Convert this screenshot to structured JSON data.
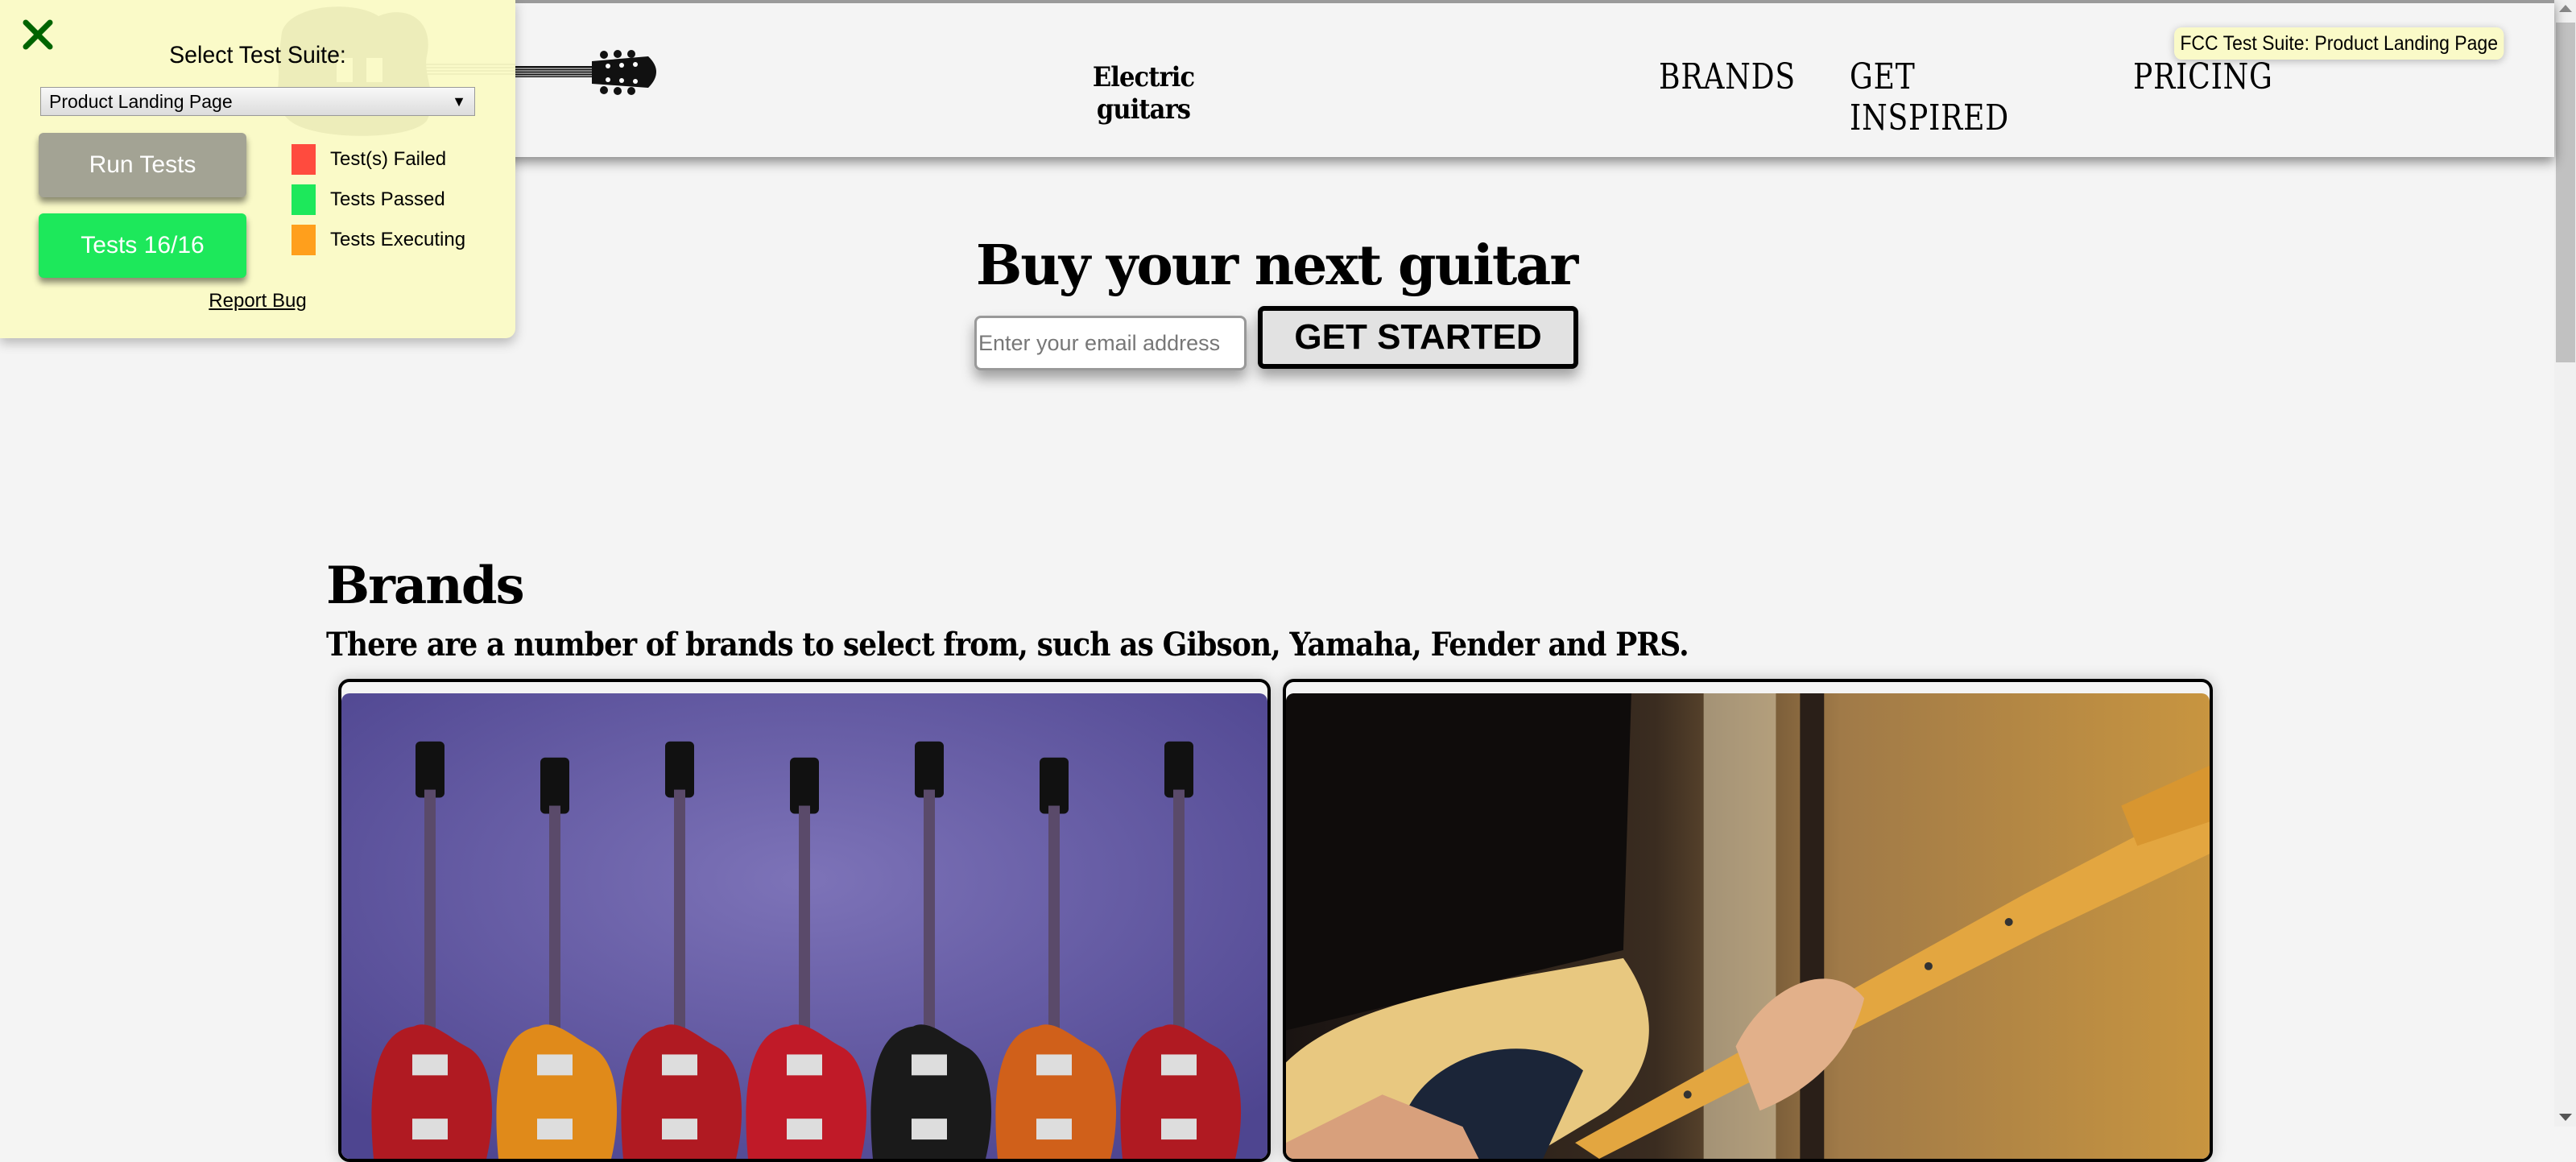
{
  "header": {
    "site_title": "Electric guitars",
    "nav": [
      {
        "label": "BRANDS"
      },
      {
        "label": "GET INSPIRED"
      },
      {
        "label": "PRICING"
      }
    ]
  },
  "tooltip": "FCC Test Suite: Product Landing Page",
  "hero": {
    "title": "Buy your next guitar",
    "email_placeholder": "Enter your email address",
    "email_value": "",
    "button_label": "GET STARTED"
  },
  "brands": {
    "heading": "Brands",
    "text": "There are a number of brands to select from, such as Gibson, Yamaha, Fender and PRS.",
    "cards": [
      {
        "image": "gibson-les-paul-guitars-photo",
        "alt": "Row of Gibson Les Paul guitars"
      },
      {
        "image": "fender-telecaster-player-photo",
        "alt": "Person playing a Fender Telecaster"
      }
    ]
  },
  "test_panel": {
    "select_label": "Select Test Suite:",
    "selected_suite": "Product Landing Page",
    "run_button": "Run Tests",
    "tests_button": "Tests 16/16",
    "tests_passed": 16,
    "tests_total": 16,
    "legend": [
      {
        "label": "Test(s) Failed",
        "color": "#ff4b3e"
      },
      {
        "label": "Tests Passed",
        "color": "#1de85b"
      },
      {
        "label": "Tests Executing",
        "color": "#ff9f1c"
      }
    ],
    "report_bug": "Report Bug",
    "colors": {
      "panel_bg": "#fafac8",
      "close_icon": "#006400"
    }
  }
}
